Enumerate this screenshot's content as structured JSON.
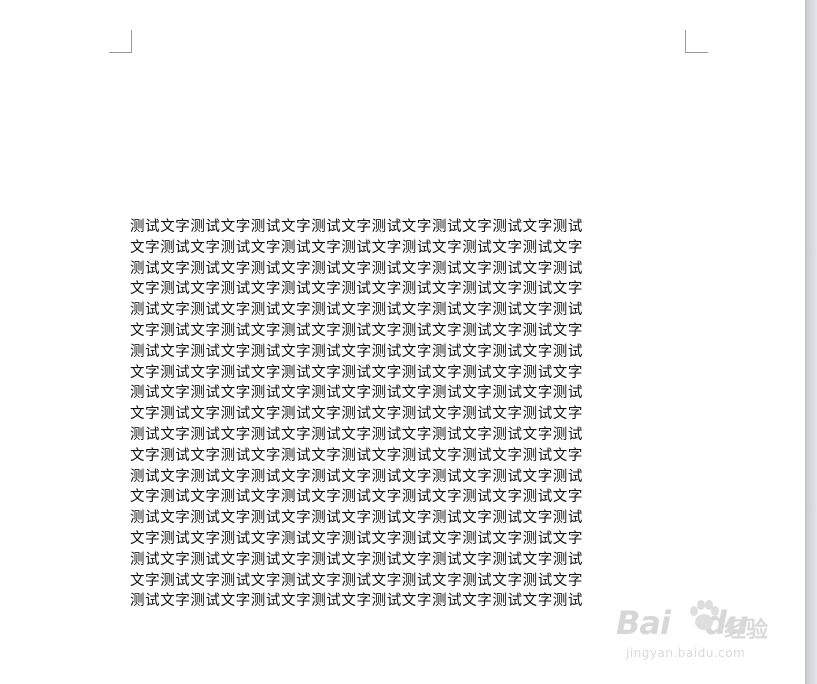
{
  "document": {
    "lines": [
      "测试文字测试文字测试文字测试文字测试文字测试文字测试文字测试",
      "文字测试文字测试文字测试文字测试文字测试文字测试文字测试文字",
      "测试文字测试文字测试文字测试文字测试文字测试文字测试文字测试",
      "文字测试文字测试文字测试文字测试文字测试文字测试文字测试文字",
      "测试文字测试文字测试文字测试文字测试文字测试文字测试文字测试",
      "文字测试文字测试文字测试文字测试文字测试文字测试文字测试文字",
      "测试文字测试文字测试文字测试文字测试文字测试文字测试文字测试",
      "文字测试文字测试文字测试文字测试文字测试文字测试文字测试文字",
      "测试文字测试文字测试文字测试文字测试文字测试文字测试文字测试",
      "文字测试文字测试文字测试文字测试文字测试文字测试文字测试文字",
      "测试文字测试文字测试文字测试文字测试文字测试文字测试文字测试",
      "文字测试文字测试文字测试文字测试文字测试文字测试文字测试文字",
      "测试文字测试文字测试文字测试文字测试文字测试文字测试文字测试",
      "文字测试文字测试文字测试文字测试文字测试文字测试文字测试文字",
      "测试文字测试文字测试文字测试文字测试文字测试文字测试文字测试",
      "文字测试文字测试文字测试文字测试文字测试文字测试文字测试文字",
      "测试文字测试文字测试文字测试文字测试文字测试文字测试文字测试",
      "文字测试文字测试文字测试文字测试文字测试文字测试文字测试文字",
      "测试文字测试文字测试文字测试文字测试文字测试文字测试文字测试"
    ]
  },
  "watermark": {
    "logo": "Bai",
    "logo_suffix": "du",
    "jingyan": "经验",
    "url": "jingyan.baidu.com"
  },
  "colors": {
    "text": "#111111",
    "page": "#ffffff",
    "background": "#d6d9de",
    "crop_mark": "#9a9a9a",
    "watermark": "#bdbdbd"
  }
}
